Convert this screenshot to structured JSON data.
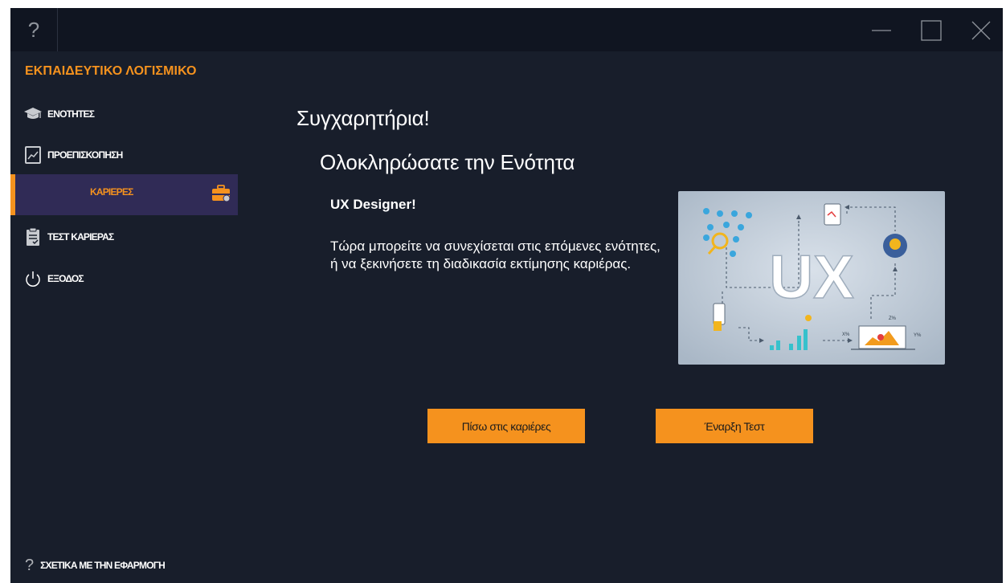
{
  "titlebar": {
    "help_glyph": "?"
  },
  "sidebar": {
    "app_title": "ΕΚΠΑΙΔΕΥΤΙΚΟ ΛΟΓΙΣΜΙΚΟ",
    "items": [
      {
        "label": "ΕΝΟΤΗΤΕΣ",
        "icon": "graduation-cap-icon",
        "active": false
      },
      {
        "label": "ΠΡΟΕΠΙΣΚΟΠΗΣΗ",
        "icon": "chart-icon",
        "active": false
      },
      {
        "label": "ΚΑΡΙΕΡΕΣ",
        "icon": "briefcase-icon",
        "active": true
      },
      {
        "label": "ΤΕΣΤ ΚΑΡΙΕΡΑΣ",
        "icon": "clipboard-icon",
        "active": false
      },
      {
        "label": "ΕΞΟΔΟΣ",
        "icon": "power-icon",
        "active": false
      }
    ],
    "about_glyph": "?",
    "about_label": "ΣΧΕΤΙΚΑ ΜΕ ΤΗΝ ΕΦΑΡΜΟΓΗ"
  },
  "main": {
    "heading": "Συγχαρητήρια!",
    "subheading": "Ολοκληρώσατε την Ενότητα",
    "module_name": "UX Designer!",
    "description": "Τώρα μπορείτε να συνεχίσεται στις επόμενες ενότητες, ή να ξεκινήσετε τη διαδικασία εκτίμησης καριέρας.",
    "illustration": {
      "main_text": "UX",
      "label_left": "X%",
      "label_right": "Y%",
      "label_top": "Z%"
    },
    "back_button": "Πίσω στις καριέρες",
    "start_button": "Έναρξη Τεστ"
  },
  "colors": {
    "accent": "#f5921e",
    "background": "#181e2b",
    "titlebar": "#101521",
    "active_item": "#302b56"
  }
}
